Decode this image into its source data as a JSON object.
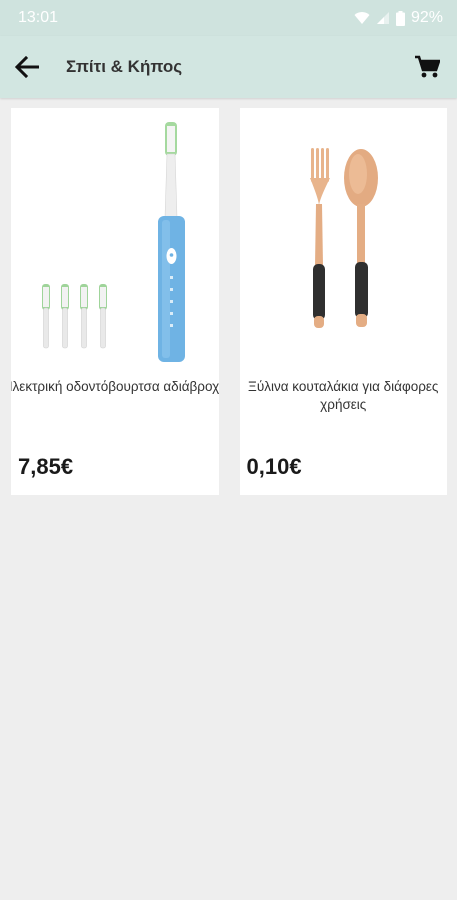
{
  "status_bar": {
    "time": "13:01",
    "battery": "92%",
    "icons": [
      "wifi-icon",
      "signal-icon",
      "battery-icon"
    ]
  },
  "app_bar": {
    "title": "Σπίτι & Κήπος",
    "back_icon": "arrow-left-icon",
    "cart_icon": "cart-icon"
  },
  "products": [
    {
      "name": "Ηλεκτρική οδοντόβουρτσα αδιάβροχη",
      "price": "7,85€",
      "image": "electric-toothbrush"
    },
    {
      "name": "Ξύλινα κουταλάκια για διάφορες χρήσεις",
      "price": "0,10€",
      "image": "wooden-fork-spoon"
    }
  ],
  "colors": {
    "app_bar_bg": "#d2e6e1",
    "page_bg": "#eeeeee",
    "toothbrush_blue": "#6fb3e4"
  }
}
